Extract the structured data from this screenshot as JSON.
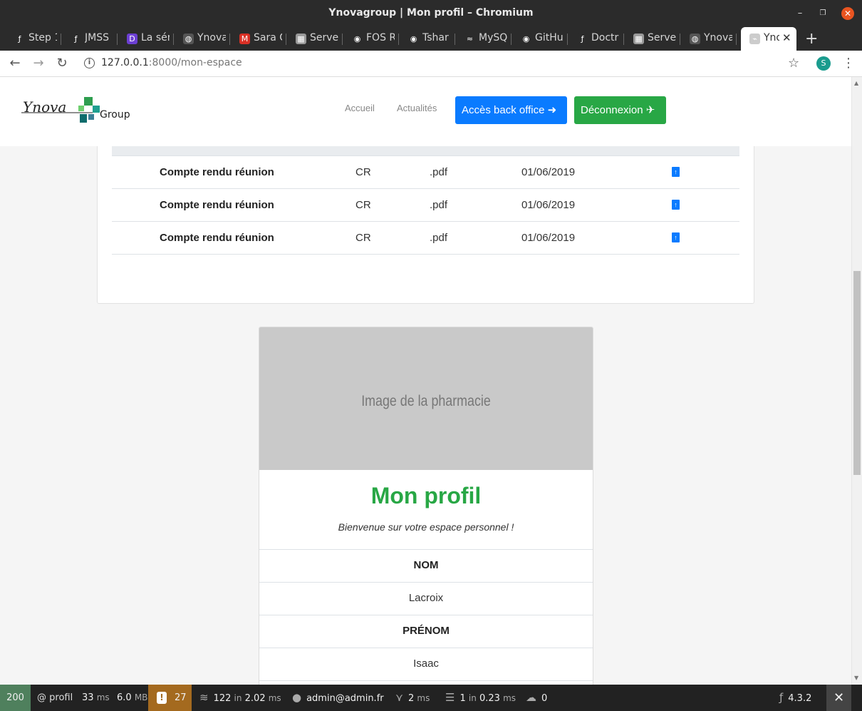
{
  "window": {
    "title": "Ynovagroup | Mon profil – Chromium"
  },
  "tabs": [
    {
      "label": "Step 1",
      "icon": "sf",
      "icon_color": "#2b2b2b"
    },
    {
      "label": "JMSS",
      "icon": "sf",
      "icon_color": "#2b2b2b"
    },
    {
      "label": "La sér",
      "icon": "D",
      "icon_color": "#6c3fd3"
    },
    {
      "label": "Ynova",
      "icon": "globe",
      "icon_color": "#555"
    },
    {
      "label": "Sara C",
      "icon": "M",
      "icon_color": "#d93025"
    },
    {
      "label": "Serve",
      "icon": "sq",
      "icon_color": "#999"
    },
    {
      "label": "FOS R",
      "icon": "gh",
      "icon_color": "#2b2b2b"
    },
    {
      "label": "Tshar",
      "icon": "gh",
      "icon_color": "#2b2b2b"
    },
    {
      "label": "MySQ",
      "icon": "db",
      "icon_color": "#2b2b2b"
    },
    {
      "label": "GitHu",
      "icon": "gh",
      "icon_color": "#2b2b2b"
    },
    {
      "label": "Doctr",
      "icon": "sf",
      "icon_color": "#2b2b2b"
    },
    {
      "label": "Serve",
      "icon": "sq",
      "icon_color": "#999"
    },
    {
      "label": "Ynova",
      "icon": "globe",
      "icon_color": "#555"
    },
    {
      "label": "Yno",
      "icon": "logo",
      "icon_color": "#ccc"
    }
  ],
  "address": {
    "host": "127.0.0.1",
    "path": ":8000/mon-espace"
  },
  "site": {
    "logo_text": "Ynova",
    "logo_group": "Group",
    "nav": {
      "home": "Accueil",
      "news": "Actualités"
    },
    "btn_backoffice": "Accès back office",
    "btn_logout": "Déconnexion"
  },
  "documents": [
    {
      "name": "Compte rendu réunion",
      "type": "CR",
      "ext": ".pdf",
      "date": "01/06/2019"
    },
    {
      "name": "Compte rendu réunion",
      "type": "CR",
      "ext": ".pdf",
      "date": "01/06/2019"
    },
    {
      "name": "Compte rendu réunion",
      "type": "CR",
      "ext": ".pdf",
      "date": "01/06/2019"
    }
  ],
  "profile": {
    "image_placeholder": "Image de la pharmacie",
    "title": "Mon profil",
    "subtitle": "Bienvenue sur votre espace personnel !",
    "nom_label": "NOM",
    "nom_value": "Lacroix",
    "prenom_label": "PRÉNOM",
    "prenom_value": "Isaac"
  },
  "debug_toolbar": {
    "status": "200",
    "route": "@ profil",
    "time_value": "33",
    "time_unit": "ms",
    "memory_value": "6.0",
    "memory_unit": "MB",
    "warnings": "27",
    "db_queries": "122",
    "db_in": "in",
    "db_time": "2.02",
    "db_unit": "ms",
    "user": "admin@admin.fr",
    "cache_value": "2",
    "cache_unit": "ms",
    "server_count": "1",
    "server_in": "in",
    "server_time": "0.23",
    "server_unit": "ms",
    "ajax": "0",
    "version": "4.3.2"
  },
  "colors": {
    "primary": "#0a7bff",
    "success": "#28a745",
    "toolbar_ok": "#4f805d",
    "toolbar_warn": "#a46a1f"
  }
}
